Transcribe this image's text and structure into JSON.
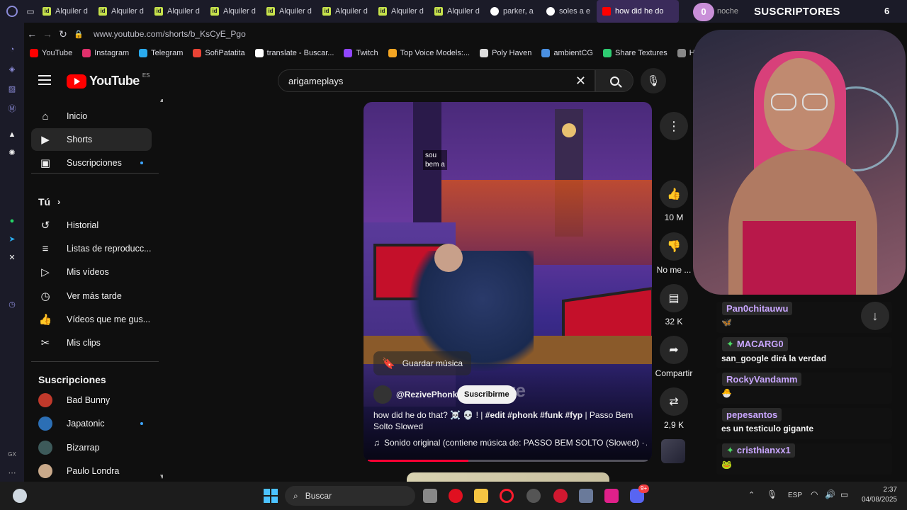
{
  "browser": {
    "tabs": [
      {
        "label": "Alquiler d",
        "icon": "id-icon"
      },
      {
        "label": "Alquiler d",
        "icon": "id-icon"
      },
      {
        "label": "Alquiler d",
        "icon": "id-icon"
      },
      {
        "label": "Alquiler d",
        "icon": "id-icon"
      },
      {
        "label": "Alquiler d",
        "icon": "id-icon"
      },
      {
        "label": "Alquiler d",
        "icon": "id-icon"
      },
      {
        "label": "Alquiler d",
        "icon": "id-icon"
      },
      {
        "label": "Alquiler d",
        "icon": "id-icon"
      },
      {
        "label": "parker, a",
        "icon": "google-icon"
      },
      {
        "label": "soles a e",
        "icon": "google-icon"
      },
      {
        "label": "how did he do",
        "icon": "youtube-icon"
      }
    ],
    "tab_count": "6",
    "overlay_text": "SUSCRIPTORES",
    "overlay_counter": "0",
    "overlay_noche": "noche",
    "url": "www.youtube.com/shorts/b_KsCyE_Pgo",
    "bookmarks": [
      {
        "label": "YouTube",
        "color": "#ff0000"
      },
      {
        "label": "Instagram",
        "color": "#e1306c"
      },
      {
        "label": "Telegram",
        "color": "#2aabee"
      },
      {
        "label": "SofiPatatita",
        "color": "#ea4335"
      },
      {
        "label": "translate - Buscar...",
        "color": "#ffffff"
      },
      {
        "label": "Twitch",
        "color": "#9146ff"
      },
      {
        "label": "Top Voice Models:...",
        "color": "#f5a623"
      },
      {
        "label": "Poly Haven",
        "color": "#dddddd"
      },
      {
        "label": "ambientCG",
        "color": "#4a90e2"
      },
      {
        "label": "Share Textures",
        "color": "#2ecc71"
      },
      {
        "label": "Ha",
        "color": "#888888"
      }
    ]
  },
  "youtube": {
    "logo_text": "YouTube",
    "region": "ES",
    "search_value": "arigameplays",
    "sidebar": {
      "items": [
        {
          "label": "Inicio",
          "icon": "home-icon"
        },
        {
          "label": "Shorts",
          "icon": "shorts-icon"
        },
        {
          "label": "Suscripciones",
          "icon": "subscriptions-icon"
        }
      ],
      "tu_heading": "Tú",
      "tu_items": [
        {
          "label": "Historial",
          "icon": "history-icon"
        },
        {
          "label": "Listas de reproducc...",
          "icon": "playlist-icon"
        },
        {
          "label": "Mis vídeos",
          "icon": "my-videos-icon"
        },
        {
          "label": "Ver más tarde",
          "icon": "watch-later-icon"
        },
        {
          "label": "Vídeos que me gus...",
          "icon": "liked-icon"
        },
        {
          "label": "Mis clips",
          "icon": "clips-icon"
        }
      ],
      "subs_heading": "Suscripciones",
      "subs": [
        {
          "label": "Bad Bunny",
          "color": "#c0392b"
        },
        {
          "label": "Japatonic",
          "color": "#2c6fb5"
        },
        {
          "label": "Bizarrap",
          "color": "#3d5a5a"
        },
        {
          "label": "Paulo Londra",
          "color": "#c9a98a"
        }
      ]
    },
    "short": {
      "overlay_caption_1": "sou",
      "overlay_caption_2": "bem a",
      "save_music": "Guardar música",
      "channel": "@RezivePhonk",
      "subscribe": "Suscribirme",
      "title_plain": "how did he do that? ☠️ 💀 ! |",
      "title_tags": "#edit #phonk #funk #fyp",
      "title_rest": "| Passo Bem Solto Slowed",
      "sound": "Sonido original (contiene música de: PASSO BEM SOLTO (Slowed) · AT",
      "watermark": "ve"
    },
    "actions": {
      "likes": "10 M",
      "dislike": "No me ...",
      "comments": "32 K",
      "share": "Compartir",
      "remix": "2,9 K"
    }
  },
  "chat": {
    "messages": [
      {
        "user": "Pan0chitauwu",
        "text": "🦋",
        "badge": ""
      },
      {
        "user": "MACARG0",
        "text": "san_google dirá la verdad",
        "badge": "✦"
      },
      {
        "user": "RockyVandamm",
        "text": "🐣",
        "badge": ""
      },
      {
        "user": "pepesantos",
        "text": "es un testiculo gigante",
        "badge": ""
      },
      {
        "user": "cristhianxx1",
        "text": "🐸",
        "badge": "✦"
      }
    ]
  },
  "taskbar": {
    "search_placeholder": "Buscar",
    "lang": "ESP",
    "time": "2:37",
    "date": "04/08/2025",
    "discord_badge": "9+"
  }
}
